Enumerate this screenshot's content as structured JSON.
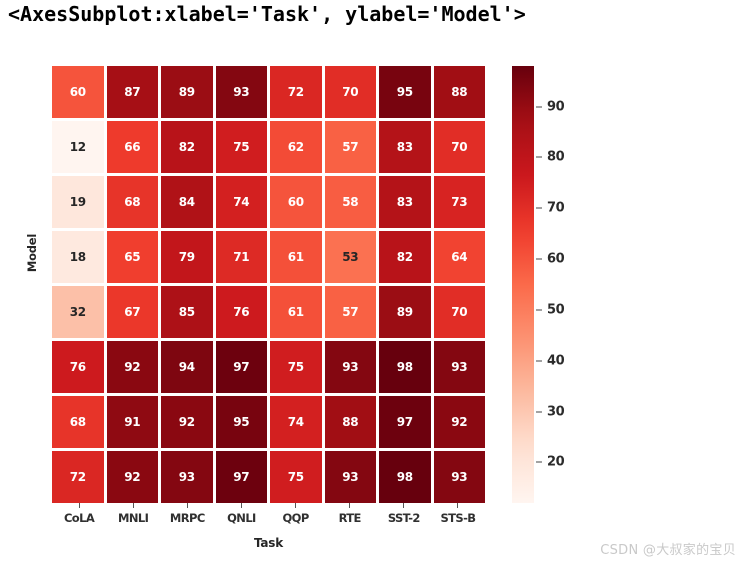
{
  "repr_title": "<AxesSubplot:xlabel='Task', ylabel='Model'>",
  "watermark": "CSDN @大叔家的宝贝",
  "colors": {
    "background": "#ffffff",
    "cmap_low": "#fff5f0",
    "cmap_high": "#67000d",
    "dark_text": "#262626",
    "light_text": "#ffffff",
    "tick_color": "#444444"
  },
  "chart_data": {
    "type": "heatmap",
    "title": "",
    "xlabel": "Task",
    "ylabel": "Model",
    "colormap": "Reds",
    "grid": false,
    "annotated": true,
    "legend_position": "right",
    "colorbar": {
      "ticks": [
        90,
        80,
        70,
        60,
        50,
        40,
        30,
        20
      ],
      "vmin": 12,
      "vmax": 98
    },
    "categories": [
      "CoLA",
      "MNLI",
      "MRPC",
      "QNLI",
      "QQP",
      "RTE",
      "SST-2",
      "STS-B"
    ],
    "rows": [
      "",
      "",
      "",
      "",
      "",
      "",
      "",
      ""
    ],
    "values": [
      [
        60,
        87,
        89,
        93,
        72,
        70,
        95,
        88
      ],
      [
        12,
        66,
        82,
        75,
        62,
        57,
        83,
        70
      ],
      [
        19,
        68,
        84,
        74,
        60,
        58,
        83,
        73
      ],
      [
        18,
        65,
        79,
        71,
        61,
        53,
        82,
        64
      ],
      [
        32,
        67,
        85,
        76,
        61,
        57,
        89,
        70
      ],
      [
        76,
        92,
        94,
        97,
        75,
        93,
        98,
        93
      ],
      [
        68,
        91,
        92,
        95,
        74,
        88,
        97,
        92
      ],
      [
        72,
        92,
        93,
        97,
        75,
        93,
        98,
        93
      ]
    ]
  }
}
